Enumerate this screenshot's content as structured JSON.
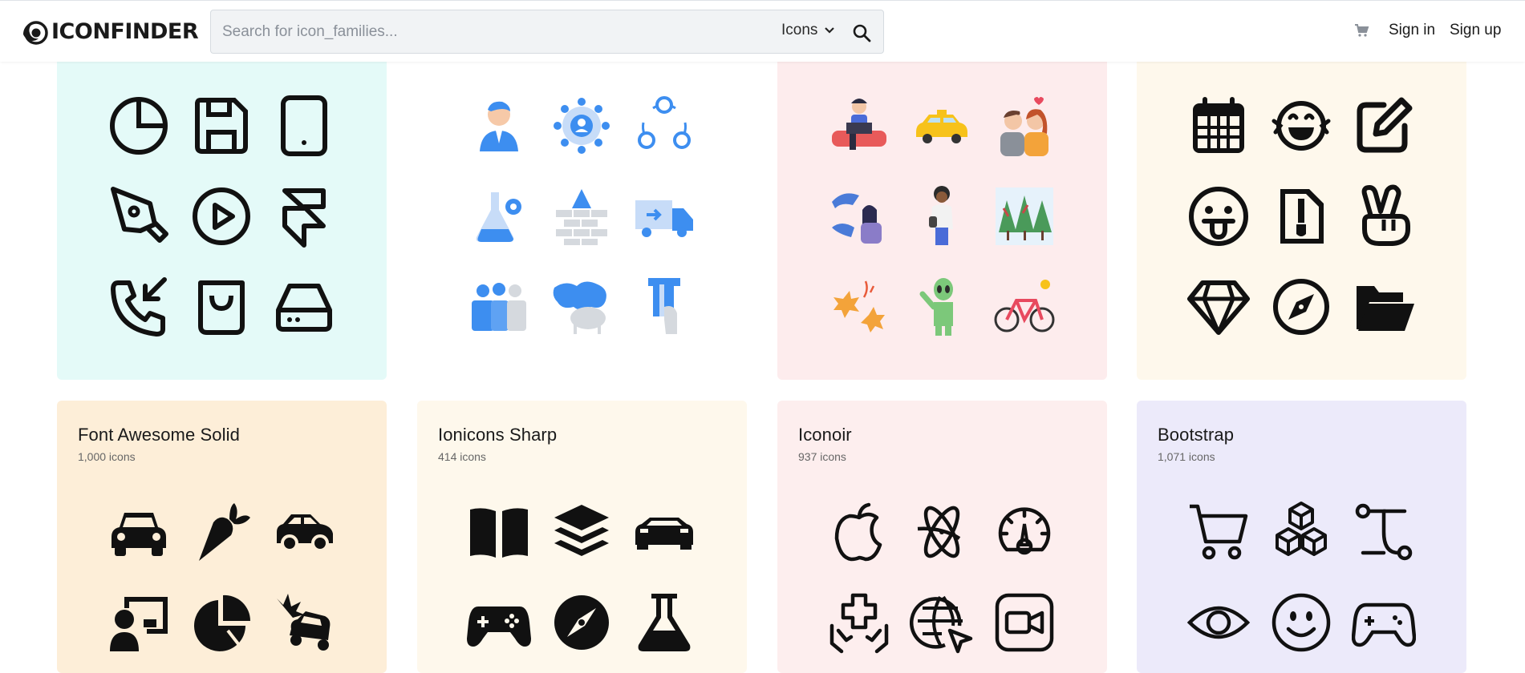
{
  "header": {
    "logo_text": "ICONFINDER",
    "search_placeholder": "Search for icon_families...",
    "search_value": "",
    "type_selected": "Icons",
    "sign_in": "Sign in",
    "sign_up": "Sign up",
    "icons": {
      "logo": "eye-logo-icon",
      "chevron": "chevron-down-icon",
      "search": "search-icon",
      "cart": "cart-icon"
    }
  },
  "colors": {
    "card_cyan": "#e4faf8",
    "card_white": "#ffffff",
    "card_pink": "#fdeced",
    "card_cream": "#fef8ec",
    "card_orange": "#fdeed8",
    "card_lightcream": "#fef8ec",
    "card_lightpink": "#fdeeee",
    "card_lavender": "#eceafa",
    "accent_blue": "#3d8ef0"
  },
  "families_top": [
    {
      "icons": [
        "pie-chart-icon",
        "floppy-disk-icon",
        "tablet-icon",
        "pen-nib-icon",
        "play-circle-icon",
        "framer-icon",
        "phone-incoming-icon",
        "shopping-bag-icon",
        "hard-drive-icon"
      ]
    },
    {
      "icons": [
        "businessman-icon",
        "network-user-icon",
        "user-cycle-icon",
        "lab-flask-gear-icon",
        "brick-wall-icon",
        "delivery-truck-icon",
        "team-puzzle-icon",
        "world-map-person-icon",
        "credit-card-hand-icon"
      ]
    },
    {
      "icons": [
        "person-laptop-couch-icon",
        "taxi-icon",
        "couple-love-icon",
        "dolphins-girl-icon",
        "woman-standing-icon",
        "winter-trees-icon",
        "autumn-leaves-icon",
        "alien-icon",
        "bicycle-icon"
      ]
    },
    {
      "icons": [
        "calendar-icon",
        "laughing-face-icon",
        "edit-icon",
        "tongue-face-icon",
        "zip-file-icon",
        "peace-hand-icon",
        "diamond-icon",
        "compass-icon",
        "folder-open-icon"
      ]
    }
  ],
  "families_bottom": [
    {
      "title": "Font Awesome Solid",
      "count": "1,000 icons",
      "icons": [
        "car-front-icon",
        "carrot-icon",
        "car-side-icon",
        "chalkboard-user-icon",
        "chart-pie-icon",
        "car-burst-icon"
      ]
    },
    {
      "title": "Ionicons Sharp",
      "count": "414 icons",
      "icons": [
        "book-icon",
        "layers-icon",
        "car-sport-icon",
        "game-controller-icon",
        "compass-icon",
        "flask-icon"
      ]
    },
    {
      "title": "Iconoir",
      "count": "937 icons",
      "icons": [
        "apple-icon",
        "atom-icon",
        "dashboard-speed-icon",
        "hands-health-icon",
        "globe-cursor-icon",
        "video-camera-icon"
      ]
    },
    {
      "title": "Bootstrap",
      "count": "1,071 icons",
      "icons": [
        "cart-icon",
        "boxes-icon",
        "bezier-icon",
        "eye-icon",
        "emoji-smile-icon",
        "controller-icon"
      ]
    }
  ]
}
